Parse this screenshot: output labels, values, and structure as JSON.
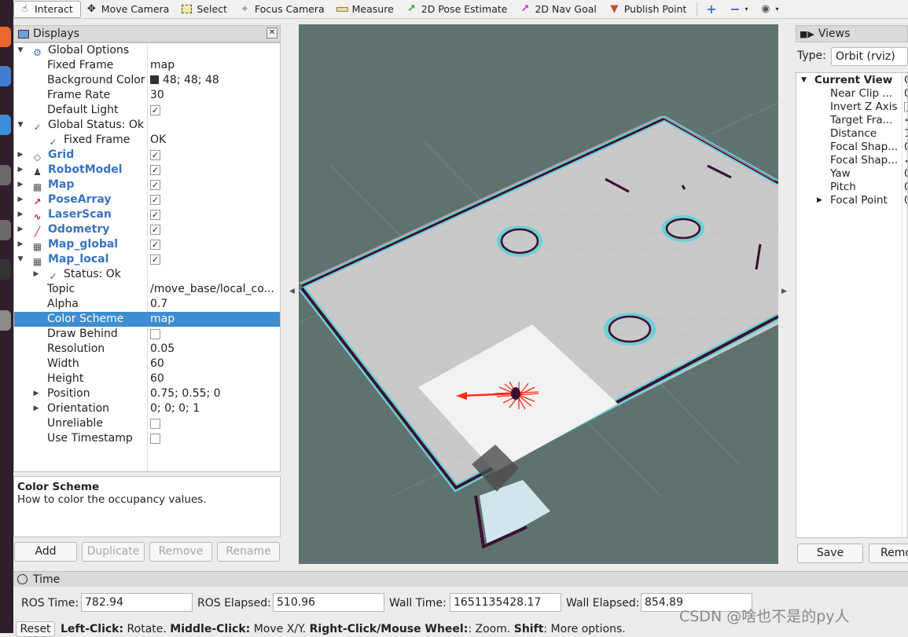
{
  "toolbar": {
    "tools": [
      {
        "label": "Interact",
        "icon": "cursor-icon"
      },
      {
        "label": "Move Camera",
        "icon": "move-camera-icon"
      },
      {
        "label": "Select",
        "icon": "select-icon"
      },
      {
        "label": "Focus Camera",
        "icon": "focus-icon"
      },
      {
        "label": "Measure",
        "icon": "ruler-icon"
      },
      {
        "label": "2D Pose Estimate",
        "icon": "green-arrow-icon"
      },
      {
        "label": "2D Nav Goal",
        "icon": "magenta-arrow-icon"
      },
      {
        "label": "Publish Point",
        "icon": "map-pin-icon"
      }
    ]
  },
  "displays": {
    "title": "Displays",
    "rows": [
      {
        "label": "Global Options",
        "value": ""
      },
      {
        "label": "Fixed Frame",
        "value": "map"
      },
      {
        "label": "Background Color",
        "value": "48; 48; 48"
      },
      {
        "label": "Frame Rate",
        "value": "30"
      },
      {
        "label": "Default Light",
        "value": ""
      },
      {
        "label": "Global Status: Ok",
        "value": ""
      },
      {
        "label": "Fixed Frame",
        "value": "OK"
      },
      {
        "label": "Grid",
        "value": ""
      },
      {
        "label": "RobotModel",
        "value": ""
      },
      {
        "label": "Map",
        "value": ""
      },
      {
        "label": "PoseArray",
        "value": ""
      },
      {
        "label": "LaserScan",
        "value": ""
      },
      {
        "label": "Odometry",
        "value": ""
      },
      {
        "label": "Map_global",
        "value": ""
      },
      {
        "label": "Map_local",
        "value": ""
      },
      {
        "label": "Status: Ok",
        "value": ""
      },
      {
        "label": "Topic",
        "value": "/move_base/local_co..."
      },
      {
        "label": "Alpha",
        "value": "0.7"
      },
      {
        "label": "Color Scheme",
        "value": "map"
      },
      {
        "label": "Draw Behind",
        "value": ""
      },
      {
        "label": "Resolution",
        "value": "0.05"
      },
      {
        "label": "Width",
        "value": "60"
      },
      {
        "label": "Height",
        "value": "60"
      },
      {
        "label": "Position",
        "value": "0.75; 0.55; 0"
      },
      {
        "label": "Orientation",
        "value": "0; 0; 0; 1"
      },
      {
        "label": "Unreliable",
        "value": ""
      },
      {
        "label": "Use Timestamp",
        "value": ""
      }
    ],
    "checks": [
      "✓",
      "✓",
      "✓",
      "✓",
      "✓",
      "✓",
      "✓",
      "✓",
      "✓"
    ],
    "description": {
      "title": "Color Scheme",
      "text": "How to color the occupancy values."
    },
    "buttons": {
      "add": "Add",
      "duplicate": "Duplicate",
      "remove": "Remove",
      "rename": "Rename"
    }
  },
  "views": {
    "title": "Views",
    "type_label": "Type:",
    "type_value": "Orbit (rviz)",
    "rows": [
      {
        "label": "Current View",
        "value": "O"
      },
      {
        "label": "Near Clip ...",
        "value": "0"
      },
      {
        "label": "Invert Z Axis",
        "value": ""
      },
      {
        "label": "Target Fra...",
        "value": "<"
      },
      {
        "label": "Distance",
        "value": "1"
      },
      {
        "label": "Focal Shap...",
        "value": "0"
      },
      {
        "label": "Focal Shap...",
        "value": "✓"
      },
      {
        "label": "Yaw",
        "value": "0"
      },
      {
        "label": "Pitch",
        "value": "0"
      },
      {
        "label": "Focal Point",
        "value": "0"
      }
    ],
    "save": "Save",
    "remove": "Remo"
  },
  "time": {
    "title": "Time",
    "ros_time_label": "ROS Time:",
    "ros_time": "782.94",
    "ros_elapsed_label": "ROS Elapsed:",
    "ros_elapsed": "510.96",
    "wall_time_label": "Wall Time:",
    "wall_time": "1651135428.17",
    "wall_elapsed_label": "Wall Elapsed:",
    "wall_elapsed": "854.89"
  },
  "status": {
    "reset": "Reset",
    "hint_parts": [
      {
        "b": "Left-Click:",
        "t": " Rotate. "
      },
      {
        "b": "Middle-Click:",
        "t": " Move X/Y. "
      },
      {
        "b": "Right-Click/Mouse Wheel:",
        "t": ": Zoom. "
      },
      {
        "b": "Shift",
        "t": ": More options."
      }
    ]
  },
  "watermark": "CSDN @啥也不是的py人",
  "colors": {
    "selection": "#3d8ed0",
    "viewport_bg": "#5e7370",
    "display_name_blue": "#3a73c2"
  }
}
